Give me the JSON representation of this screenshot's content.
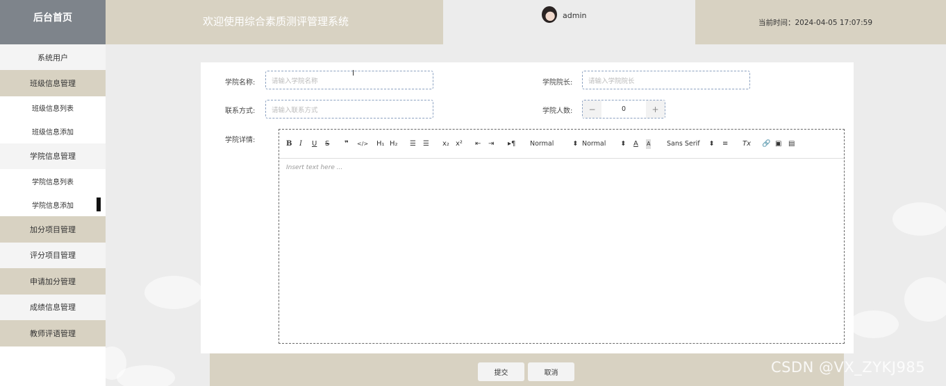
{
  "header": {
    "logo": "后台首页",
    "title": "欢迎使用综合素质测评管理系统",
    "username": "admin",
    "time": "当前时间：2024-04-05 17:07:59"
  },
  "sidebar": {
    "items": [
      {
        "label": "系统用户"
      },
      {
        "label": "班级信息管理"
      },
      {
        "label": "班级信息列表"
      },
      {
        "label": "班级信息添加"
      },
      {
        "label": "学院信息管理"
      },
      {
        "label": "学院信息列表"
      },
      {
        "label": "学院信息添加"
      },
      {
        "label": "加分项目管理"
      },
      {
        "label": "评分项目管理"
      },
      {
        "label": "申请加分管理"
      },
      {
        "label": "成绩信息管理"
      },
      {
        "label": "教师评语管理"
      }
    ]
  },
  "form": {
    "college_name_label": "学院名称:",
    "college_name_placeholder": "请输入学院名称",
    "dean_label": "学院院长:",
    "dean_placeholder": "请输入学院院长",
    "contact_label": "联系方式:",
    "contact_placeholder": "请输入联系方式",
    "count_label": "学院人数:",
    "count_value": "0",
    "detail_label": "学院详情:"
  },
  "editor": {
    "header_select_1": "Normal",
    "header_select_2": "Normal",
    "font_select": "Sans Serif",
    "placeholder": "Insert text here ..."
  },
  "actions": {
    "submit": "提交",
    "cancel": "取消"
  },
  "watermark": "CSDN @VX_ZYKJ985"
}
